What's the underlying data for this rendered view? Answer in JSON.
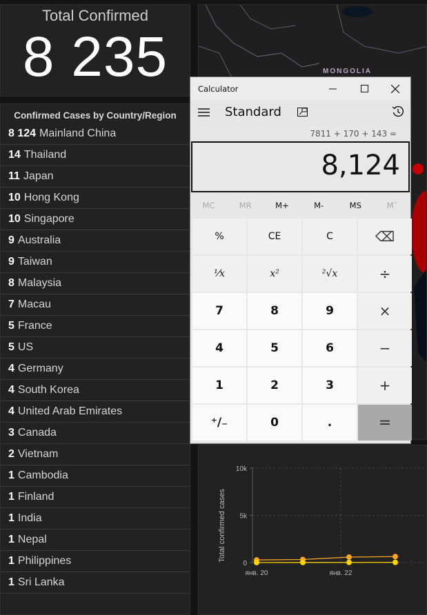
{
  "total": {
    "title": "Total Confirmed",
    "value": "8 235"
  },
  "countries": {
    "title": "Confirmed Cases by Country/Region",
    "items": [
      {
        "count": "8 124",
        "name": "Mainland China"
      },
      {
        "count": "14",
        "name": "Thailand"
      },
      {
        "count": "11",
        "name": "Japan"
      },
      {
        "count": "10",
        "name": "Hong Kong"
      },
      {
        "count": "10",
        "name": "Singapore"
      },
      {
        "count": "9",
        "name": "Australia"
      },
      {
        "count": "9",
        "name": "Taiwan"
      },
      {
        "count": "8",
        "name": "Malaysia"
      },
      {
        "count": "7",
        "name": "Macau"
      },
      {
        "count": "5",
        "name": "France"
      },
      {
        "count": "5",
        "name": "US"
      },
      {
        "count": "4",
        "name": "Germany"
      },
      {
        "count": "4",
        "name": "South Korea"
      },
      {
        "count": "4",
        "name": "United Arab Emirates"
      },
      {
        "count": "3",
        "name": "Canada"
      },
      {
        "count": "2",
        "name": "Vietnam"
      },
      {
        "count": "1",
        "name": "Cambodia"
      },
      {
        "count": "1",
        "name": "Finland"
      },
      {
        "count": "1",
        "name": "India"
      },
      {
        "count": "1",
        "name": "Nepal"
      },
      {
        "count": "1",
        "name": "Philippines"
      },
      {
        "count": "1",
        "name": "Sri Lanka"
      }
    ]
  },
  "map": {
    "label": "MONGOLIA"
  },
  "calculator": {
    "title": "Calculator",
    "mode": "Standard",
    "expression": "7811 + 170 + 143 =",
    "display": "8,124",
    "memory": [
      "MC",
      "MR",
      "M+",
      "M-",
      "MS",
      "Mˇ"
    ],
    "keys": [
      "%",
      "CE",
      "C",
      "⌫",
      "⅟x",
      "x²",
      "²√x",
      "÷",
      "7",
      "8",
      "9",
      "×",
      "4",
      "5",
      "6",
      "−",
      "1",
      "2",
      "3",
      "+",
      "⁺/₋",
      "0",
      ".",
      "="
    ]
  },
  "chart_data": {
    "type": "line",
    "title": "",
    "xlabel": "",
    "ylabel": "Total confirmed cases",
    "y_ticks": [
      "0",
      "5k",
      "10k"
    ],
    "ylim": [
      0,
      10000
    ],
    "x_ticks": [
      "янв. 20",
      "янв. 22"
    ],
    "x": [
      "янв. 20",
      "янв. 21",
      "янв. 22",
      "янв. 23"
    ],
    "series": [
      {
        "values": [
          280,
          330,
          580,
          640
        ],
        "color": "#f5a623"
      },
      {
        "values": [
          10,
          15,
          20,
          25
        ],
        "color": "#ffd600"
      }
    ],
    "grid": true
  }
}
